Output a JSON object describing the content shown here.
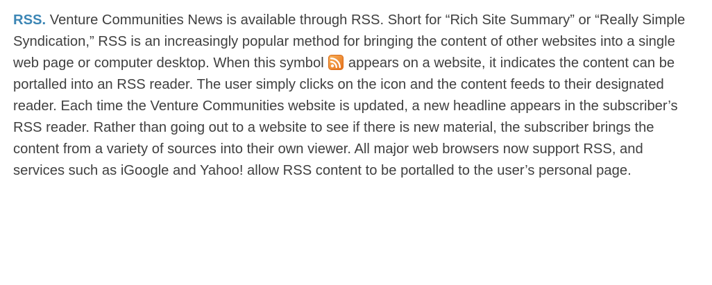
{
  "article": {
    "heading": "RSS.",
    "text_before_icon": " Venture Communities News is available through RSS. Short for “Rich Site Summary” or “Really Simple Syndication,” RSS is an increasingly popular method for bringing the content of other websites into a single web page or computer desktop. When this symbol ",
    "icon": "rss-feed-icon",
    "text_after_icon": " appears on a website, it indicates the content can be portalled into an RSS reader. The user simply clicks on the icon and the content feeds to their designated reader. Each time the Venture Communities website is updated, a new headline appears in the subscriber’s RSS reader. Rather than going out to a website to see if there is new material, the subscriber brings the content from a variety of sources into their own viewer. All major web browsers now support RSS, and services such as iGoogle and Yahoo! allow RSS content to be portalled to the user’s personal page."
  },
  "colors": {
    "heading": "#3c86b5",
    "body_text": "#3f3f3f",
    "icon_orange": "#f58220"
  }
}
